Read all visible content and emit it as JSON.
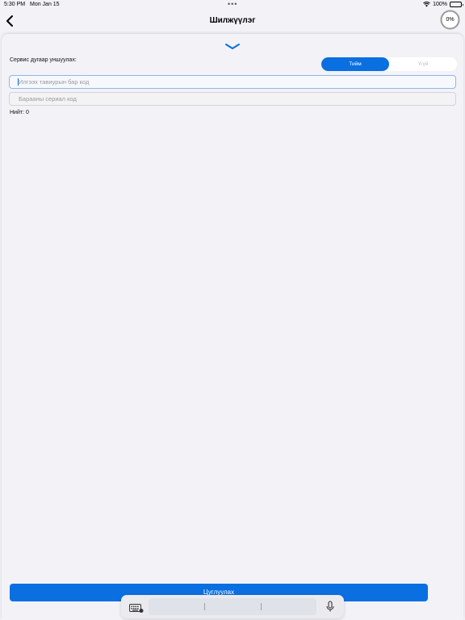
{
  "status_bar": {
    "time": "5:30 PM",
    "date": "Mon Jan 15",
    "dots": "•••",
    "battery": "100%"
  },
  "nav": {
    "title": "Шилжүүлэг",
    "progress_label": "0%",
    "progress": 0
  },
  "form": {
    "service_label": "Сервис дугаар уншуулах:",
    "toggle": {
      "yes": "Тийм",
      "no": "Үгүй",
      "selected": "yes"
    },
    "code_placeholder": "Илгээх тавиурын бар код",
    "serial_placeholder": "Барааны сериал код",
    "total_label": "Нийт: 0"
  },
  "actions": {
    "collect_label": "Цуглуулах"
  },
  "colors": {
    "accent": "#0a6fe0",
    "background": "#f2f2f7"
  },
  "icons": {
    "back": "chevron-left-icon",
    "handle": "chevron-down-icon",
    "keyboard": "keyboard-icon",
    "mic": "microphone-icon",
    "wifi": "wifi-icon",
    "battery": "battery-icon"
  }
}
